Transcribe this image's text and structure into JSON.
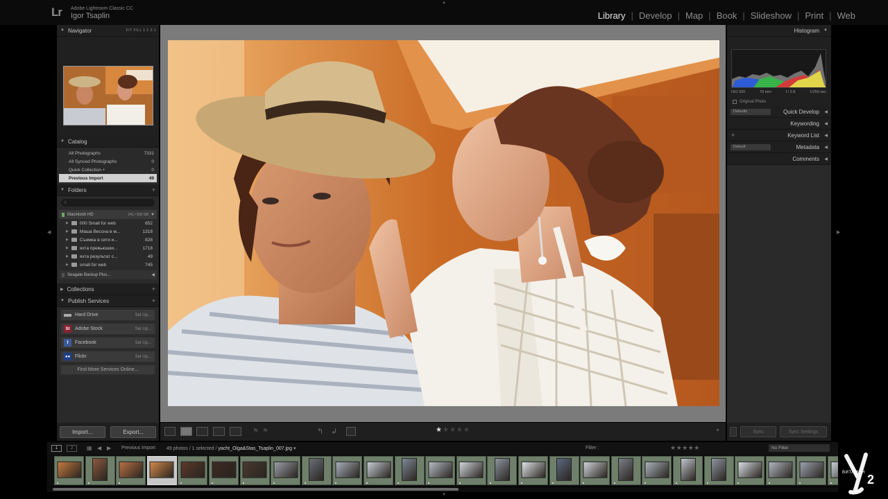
{
  "header": {
    "logo": "Lr",
    "app_name": "Adobe Lightroom Classic CC",
    "user_name": "Igor Tsaplin",
    "modules": [
      "Library",
      "Develop",
      "Map",
      "Book",
      "Slideshow",
      "Print",
      "Web"
    ],
    "active_module": "Library"
  },
  "navigator": {
    "title": "Navigator",
    "zoom_options": "FIT  FILL  1:1  3:1"
  },
  "catalog": {
    "title": "Catalog",
    "items": [
      {
        "label": "All Photographs",
        "count": "7331"
      },
      {
        "label": "All Synced Photographs",
        "count": "0"
      },
      {
        "label": "Quick Collection +",
        "count": "0"
      },
      {
        "label": "Previous Import",
        "count": "49"
      }
    ]
  },
  "folders": {
    "title": "Folders",
    "plus": "+",
    "volume": {
      "name": "Macintosh HD",
      "capacity": "241 / 500 GB"
    },
    "items": [
      {
        "label": "000 Small for web",
        "count": "652"
      },
      {
        "label": "Маша Весcна в м...",
        "count": "1318"
      },
      {
        "label": "Съемка в сити и...",
        "count": "828"
      },
      {
        "label": "яхта превьюшки...",
        "count": "1718"
      },
      {
        "label": "яхта результат с...",
        "count": "49"
      },
      {
        "label": "small for web",
        "count": "745"
      }
    ],
    "volume2": {
      "name": "Seagate Backup Plus..."
    }
  },
  "collections": {
    "title": "Collections",
    "plus": "+"
  },
  "publish_services": {
    "title": "Publish Services",
    "plus": "+",
    "items": [
      {
        "label": "Hard Drive",
        "action": "Set Up..."
      },
      {
        "label": "Adobe Stock",
        "action": "Set Up..."
      },
      {
        "label": "Facebook",
        "action": "Set Up..."
      },
      {
        "label": "Flickr",
        "action": "Set Up..."
      }
    ],
    "find_more": "Find More Services Online..."
  },
  "left_buttons": {
    "import": "Import...",
    "export": "Export..."
  },
  "histogram": {
    "title": "Histogram",
    "iso": "ISO 320",
    "focal": "70 mm",
    "aperture": "f / 2.8",
    "shutter": "1/250 sec",
    "original_photo": "Original Photo"
  },
  "right_panels": {
    "quick_develop": "Quick Develop",
    "quick_develop_preset": "Defaults",
    "keywording": "Keywording",
    "keyword_list": "Keyword List",
    "metadata": "Metadata",
    "metadata_preset": "Default",
    "comments": "Comments"
  },
  "sync": {
    "sync": "Sync",
    "sync_settings": "Sync Settings"
  },
  "toolbar": {
    "rating": 1,
    "max_rating": 5
  },
  "filmstrip_header": {
    "screen1": "1",
    "screen2": "2",
    "source": "Previous Import",
    "photos_info": "49 photos / 1 selected /",
    "filename": "yacht_Olga&Stas_Tsaplin_007.jpg",
    "filter_label": "Filter :",
    "filter_value": "No Filter"
  },
  "watermark": {
    "text": "ВИТАМИН",
    "number": "2"
  },
  "colors": {
    "panel_bg": "#2a2a2a",
    "header_bg": "#1f1f1f",
    "selected_row": "#d0d0d0",
    "filmstrip_cell": "#6e7f6a",
    "loupe_bg": "#7b7b7b"
  },
  "filmstrip_count": 26,
  "filmstrip_selected_index": 3
}
